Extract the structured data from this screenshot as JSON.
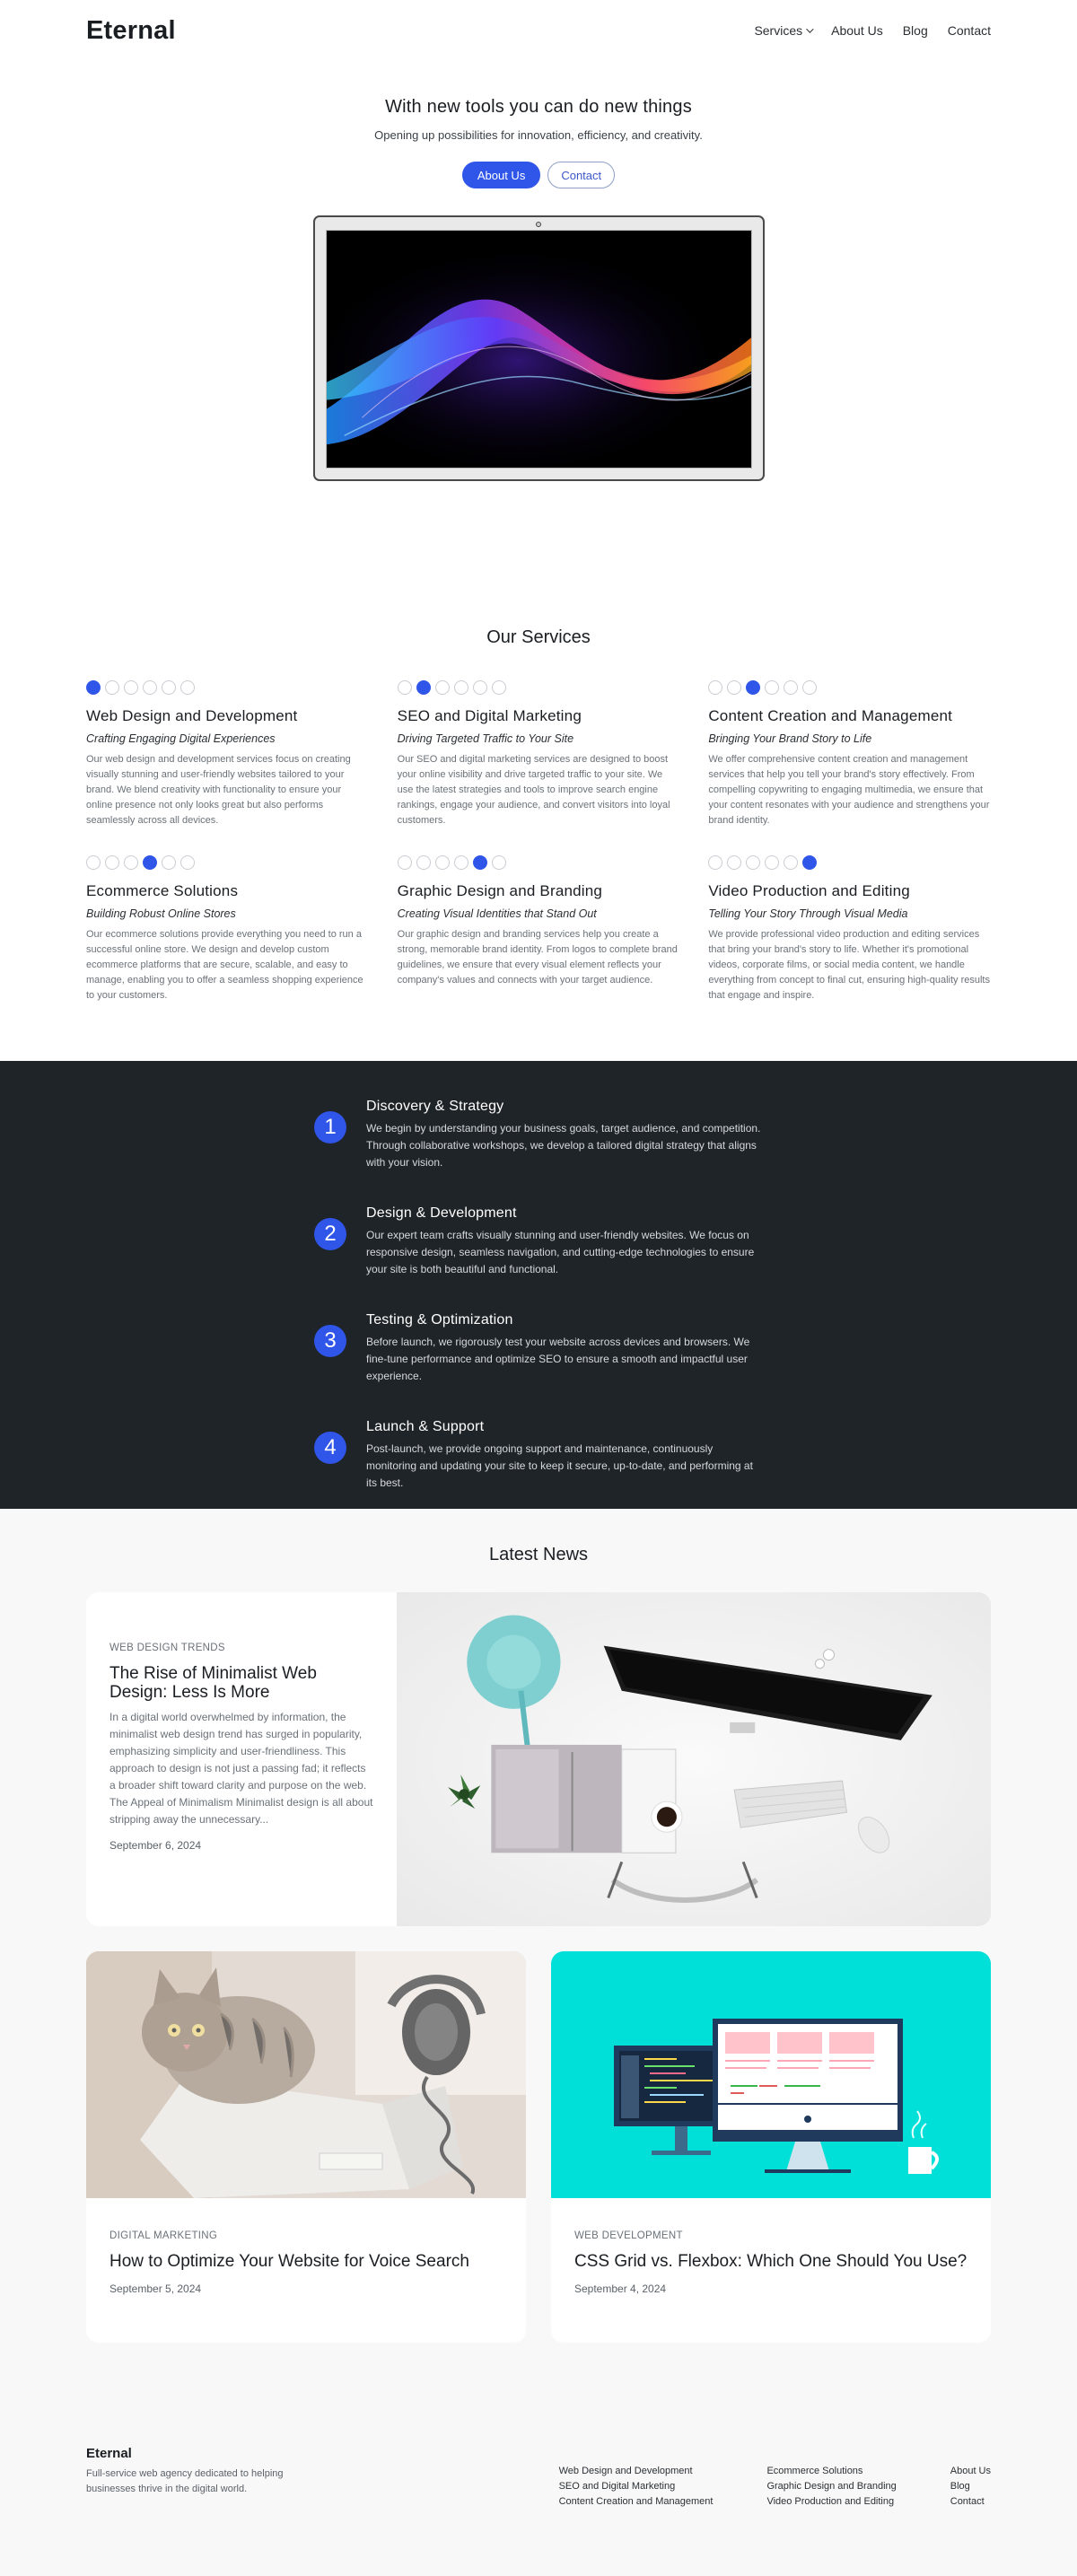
{
  "header": {
    "logo": "Eternal",
    "nav": [
      {
        "label": "Services",
        "has_dropdown": true
      },
      {
        "label": "About Us"
      },
      {
        "label": "Blog"
      },
      {
        "label": "Contact"
      }
    ]
  },
  "hero": {
    "title": "With new tools you can do new things",
    "subtitle": "Opening up possibilities for innovation, efficiency, and creativity.",
    "primary_button": "About Us",
    "secondary_button": "Contact"
  },
  "services": {
    "title": "Our Services",
    "items": [
      {
        "title": "Web Design and Development",
        "tagline": "Crafting Engaging Digital Experiences",
        "text": "Our web design and development services focus on creating visually stunning and user-friendly websites tailored to your brand. We blend creativity with functionality to ensure your online presence not only looks great but also performs seamlessly across all devices.",
        "active_dot": 1
      },
      {
        "title": "SEO and Digital Marketing",
        "tagline": "Driving Targeted Traffic to Your Site",
        "text": "Our SEO and digital marketing services are designed to boost your online visibility and drive targeted traffic to your site. We use the latest strategies and tools to improve search engine rankings, engage your audience, and convert visitors into loyal customers.",
        "active_dot": 2
      },
      {
        "title": "Content Creation and Management",
        "tagline": "Bringing Your Brand Story to Life",
        "text": "We offer comprehensive content creation and management services that help you tell your brand's story effectively. From compelling copywriting to engaging multimedia, we ensure that your content resonates with your audience and strengthens your brand identity.",
        "active_dot": 3
      },
      {
        "title": "Ecommerce Solutions",
        "tagline": "Building Robust Online Stores",
        "text": "Our ecommerce solutions provide everything you need to run a successful online store. We design and develop custom ecommerce platforms that are secure, scalable, and easy to manage, enabling you to offer a seamless shopping experience to your customers.",
        "active_dot": 4
      },
      {
        "title": "Graphic Design and Branding",
        "tagline": "Creating Visual Identities that Stand Out",
        "text": "Our graphic design and branding services help you create a strong, memorable brand identity. From logos to complete brand guidelines, we ensure that every visual element reflects your company's values and connects with your target audience.",
        "active_dot": 5
      },
      {
        "title": "Video Production and Editing",
        "tagline": "Telling Your Story Through Visual Media",
        "text": "We provide professional video production and editing services that bring your brand's story to life. Whether it's promotional videos, corporate films, or social media content, we handle everything from concept to final cut, ensuring high-quality results that engage and inspire.",
        "active_dot": 6
      }
    ]
  },
  "process": {
    "steps": [
      {
        "num": "1",
        "title": "Discovery & Strategy",
        "text": "We begin by understanding your business goals, target audience, and competition. Through collaborative workshops, we develop a tailored digital strategy that aligns with your vision."
      },
      {
        "num": "2",
        "title": "Design & Development",
        "text": "Our expert team crafts visually stunning and user-friendly websites. We focus on responsive design, seamless navigation, and cutting-edge technologies to ensure your site is both beautiful and functional."
      },
      {
        "num": "3",
        "title": "Testing & Optimization",
        "text": "Before launch, we rigorously test your website across devices and browsers. We fine-tune performance and optimize SEO to ensure a smooth and impactful user experience."
      },
      {
        "num": "4",
        "title": "Launch & Support",
        "text": "Post-launch, we provide ongoing support and maintenance, continuously monitoring and updating your site to keep it secure, up-to-date, and performing at its best."
      }
    ]
  },
  "news": {
    "title": "Latest News",
    "featured": {
      "category": "WEB DESIGN TRENDS",
      "title": "The Rise of Minimalist Web Design: Less Is More",
      "excerpt": "In a digital world overwhelmed by information, the minimalist web design trend has surged in popularity, emphasizing simplicity and user-friendliness. This approach to design is not just a passing fad; it reflects a broader shift toward clarity and purpose on the web. The Appeal of Minimalism Minimalist design is all about stripping away the unnecessary...",
      "date": "September 6, 2024"
    },
    "cards": [
      {
        "category": "DIGITAL MARKETING",
        "title": "How to Optimize Your Website for Voice Search",
        "date": "September 5, 2024"
      },
      {
        "category": "WEB DEVELOPMENT",
        "title": "CSS Grid vs. Flexbox: Which One Should You Use?",
        "date": "September 4, 2024"
      }
    ]
  },
  "footer": {
    "brand": "Eternal",
    "tagline": "Full-service web agency dedicated to helping businesses thrive in the digital world.",
    "col1": [
      "Web Design and Development",
      "SEO and Digital Marketing",
      "Content Creation and Management"
    ],
    "col2": [
      "Ecommerce Solutions",
      "Graphic Design and Branding",
      "Video Production and Editing"
    ],
    "col3": [
      "About Us",
      "Blog",
      "Contact"
    ]
  },
  "colors": {
    "accent": "#2f56e8",
    "dark_section": "#1f2429",
    "news_bg": "#f8f8f8",
    "card_teal": "#00e0d8"
  }
}
